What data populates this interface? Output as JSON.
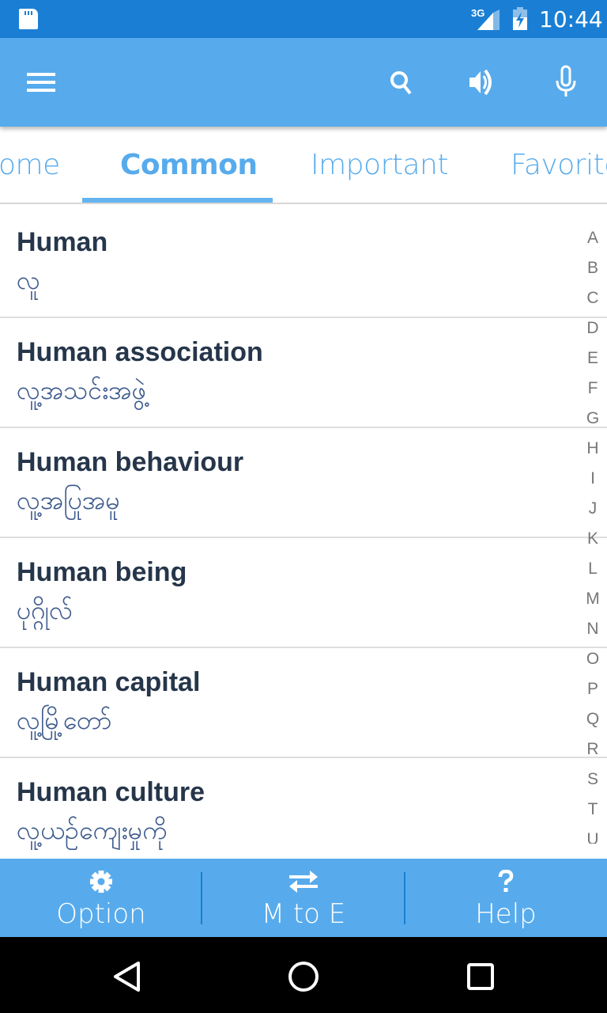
{
  "status_bar": {
    "network_type": "3G",
    "time": "10:44",
    "icons": [
      "sd-card-icon",
      "signal-icon",
      "battery-charging-icon"
    ]
  },
  "app_bar": {
    "menu_icon": "hamburger-menu-icon",
    "actions": [
      {
        "name": "search",
        "icon": "search-icon"
      },
      {
        "name": "speak",
        "icon": "speaker-icon"
      },
      {
        "name": "voice",
        "icon": "microphone-icon"
      }
    ]
  },
  "tabs": {
    "items": [
      {
        "label": "Home",
        "visible_text": "ome"
      },
      {
        "label": "Common",
        "visible_text": "Common",
        "active": true
      },
      {
        "label": "Important",
        "visible_text": "Important"
      },
      {
        "label": "Favorite",
        "visible_text": "Favorite"
      }
    ]
  },
  "entries": [
    {
      "english": "Human",
      "myanmar": "လူ"
    },
    {
      "english": "Human association",
      "myanmar": "လူ့အသင်းအဖွဲ့"
    },
    {
      "english": "Human behaviour",
      "myanmar": "လူ့အပြုအမူ"
    },
    {
      "english": "Human being",
      "myanmar": "ပုဂ္ဂိုလ်"
    },
    {
      "english": "Human capital",
      "myanmar": "လူ့မြို့တော်"
    },
    {
      "english": "Human culture",
      "myanmar": "လူ့ယဉ်ကျေးမှုကို"
    }
  ],
  "alphabet_index": [
    "A",
    "B",
    "C",
    "D",
    "E",
    "F",
    "G",
    "H",
    "I",
    "J",
    "K",
    "L",
    "M",
    "N",
    "O",
    "P",
    "Q",
    "R",
    "S",
    "T",
    "U"
  ],
  "bottom_bar": {
    "items": [
      {
        "label": "Option",
        "icon": "gear-icon"
      },
      {
        "label": "M to E",
        "icon": "swap-arrows-icon"
      },
      {
        "label": "Help",
        "icon": "question-mark-icon"
      }
    ]
  },
  "colors": {
    "status_bar": "#1a7fd4",
    "primary": "#57abec",
    "tab_text": "#57abec",
    "english_text": "#26364a",
    "myanmar_text": "#3c5a8c",
    "index_text": "#777777"
  }
}
